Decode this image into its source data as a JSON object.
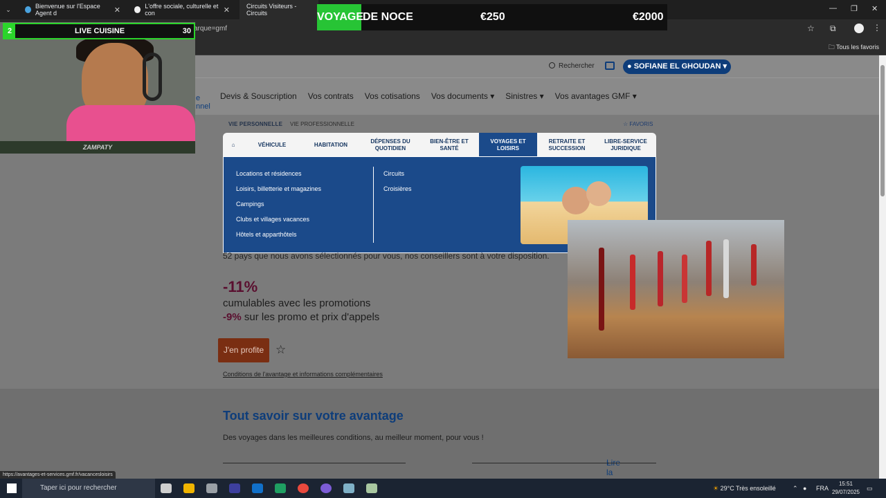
{
  "browser": {
    "tabs": [
      {
        "title": "Bienvenue sur l'Espace Agent d"
      },
      {
        "title": "L'offre sociale, culturelle et con"
      },
      {
        "title": "Circuits Visiteurs - Circuits"
      }
    ],
    "url_fragment": "arque=gmf",
    "bookmarks_label": "Tous les favoris"
  },
  "site": {
    "search_label": "Rechercher",
    "user_name": "SOFIANE EL GHOUDAN",
    "left_fragment_1": "e",
    "left_fragment_2": "nnel",
    "main_nav": [
      "Devis & Souscription",
      "Vos contrats",
      "Vos cotisations",
      "Vos documents",
      "Sinistres",
      "Vos avantages GMF"
    ],
    "sub_active": "VIE PERSONNELLE",
    "sub_other": "VIE PROFESSIONNELLE",
    "favoris": "FAVORIS",
    "menu": [
      {
        "label": "VÉHICULE"
      },
      {
        "label": "HABITATION"
      },
      {
        "label": "DÉPENSES DU QUOTIDIEN"
      },
      {
        "label": "BIEN-ÊTRE ET SANTÉ"
      },
      {
        "label": "VOYAGES ET LOISIRS"
      },
      {
        "label": "RETRAITE ET SUCCESSION"
      },
      {
        "label": "LIBRE-SERVICE JURIDIQUE"
      }
    ],
    "dropdown_left": [
      "Locations et résidences",
      "Loisirs, billetterie et magazines",
      "Campings",
      "Clubs et villages vacances",
      "Hôtels et apparthôtels"
    ],
    "dropdown_right": [
      "Circuits",
      "Croisières"
    ],
    "intro_text": "52 pays que nous avons sélectionnés pour vous, nos conseillers sont à votre disposition.",
    "discount": "-11%",
    "discount_line": "cumulables avec les promotions",
    "discount2": "-9%",
    "discount2_line": " sur les promo et prix d'appels",
    "cta": "J'en profite",
    "conditions": "Conditions de l'avantage et informations complémentaires",
    "section_title": "Tout savoir sur votre avantage",
    "section_text": "Des voyages dans les meilleures conditions, au meilleur moment, pour vous !",
    "read_more": "Lire la suite"
  },
  "status_url": "https://avantages-et-services.gmf.fr/vacancesloisirs",
  "taskbar": {
    "search_placeholder": "Taper ici pour rechercher",
    "weather": "29°C  Très ensoleillé",
    "lang": "FRA",
    "time": "15:51",
    "date": "29/07/2025"
  },
  "stream_overlay": {
    "number": "2",
    "title": "LIVE CUISINE",
    "count": "30",
    "footer": "ZAMPATY"
  },
  "ticker": {
    "word1": "VOYAGE",
    "word2": "DE NOCE",
    "price1": "€250",
    "price2": "€2000"
  }
}
